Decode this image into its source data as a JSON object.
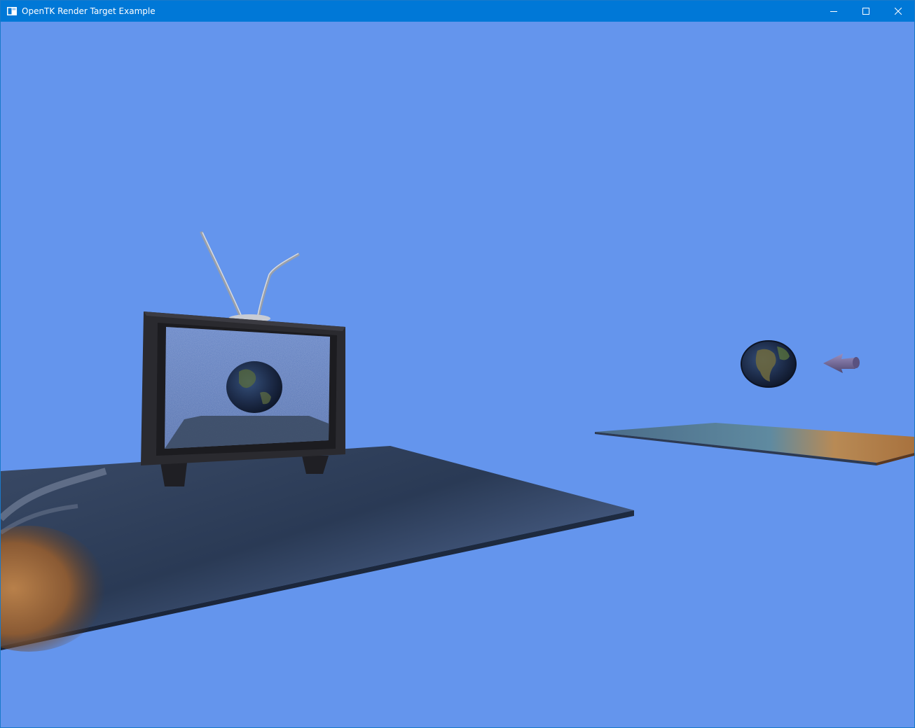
{
  "window": {
    "title": "OpenTK Render Target Example",
    "icon": "app-window-icon",
    "controls": {
      "minimize_icon": "minimize-icon",
      "maximize_icon": "maximize-icon",
      "close_icon": "close-icon"
    }
  },
  "scene": {
    "background_color": "#6495ed",
    "titlebar_color": "#0078d7",
    "objects": [
      "tv-set",
      "tv-screen-render-target",
      "earth-sphere",
      "arrow-model",
      "textured-floor-plane",
      "distant-plane"
    ]
  }
}
